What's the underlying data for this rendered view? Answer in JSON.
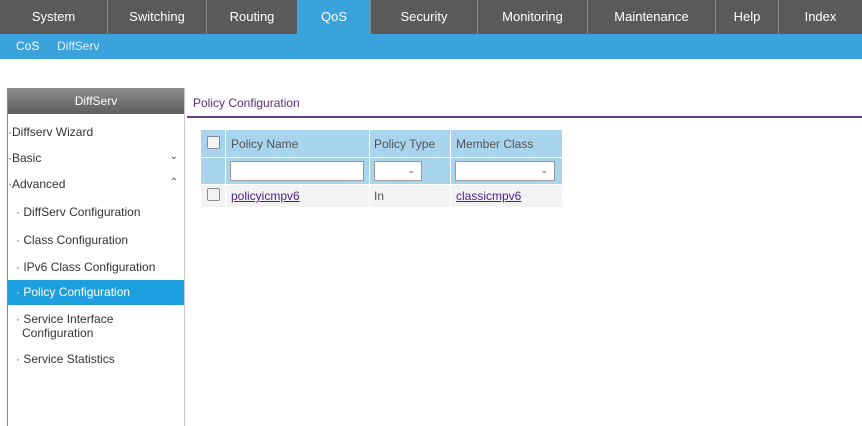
{
  "top_nav": [
    {
      "label": "System"
    },
    {
      "label": "Switching"
    },
    {
      "label": "Routing"
    },
    {
      "label": "QoS"
    },
    {
      "label": "Security"
    },
    {
      "label": "Monitoring"
    },
    {
      "label": "Maintenance"
    },
    {
      "label": "Help"
    },
    {
      "label": "Index"
    }
  ],
  "sub_nav": [
    {
      "label": "CoS"
    },
    {
      "label": "DiffServ"
    }
  ],
  "sidebar": {
    "header": "DiffServ",
    "items": [
      {
        "label": "Diffserv Wizard"
      },
      {
        "label": "Basic",
        "chevron": "chevron-down"
      },
      {
        "label": "Advanced",
        "chevron": "chevron-up"
      },
      {
        "label": "DiffServ Configuration"
      },
      {
        "label": "Class Configuration"
      },
      {
        "label": "IPv6 Class Configuration"
      },
      {
        "label": "Policy Configuration"
      },
      {
        "label": "Service Interface"
      },
      {
        "label": "Configuration"
      },
      {
        "label": "Service Statistics"
      }
    ]
  },
  "main": {
    "title": "Policy Configuration",
    "table": {
      "headers": [
        "Policy Name",
        "Policy Type",
        "Member Class"
      ],
      "filter": {
        "policy_name": "",
        "policy_type": "",
        "member_class": ""
      },
      "rows": [
        {
          "policy_name": "policyicmpv6",
          "policy_type": "In",
          "member_class": "classicmpv6"
        }
      ]
    }
  },
  "colors": {
    "nav_bg": "#5a5a5a",
    "accent": "#3aa3dc",
    "active_sidebar": "#1e9fe0",
    "link": "#4d1f86",
    "title_rule": "#6b3e8a",
    "table_header": "#a8d4ee"
  }
}
